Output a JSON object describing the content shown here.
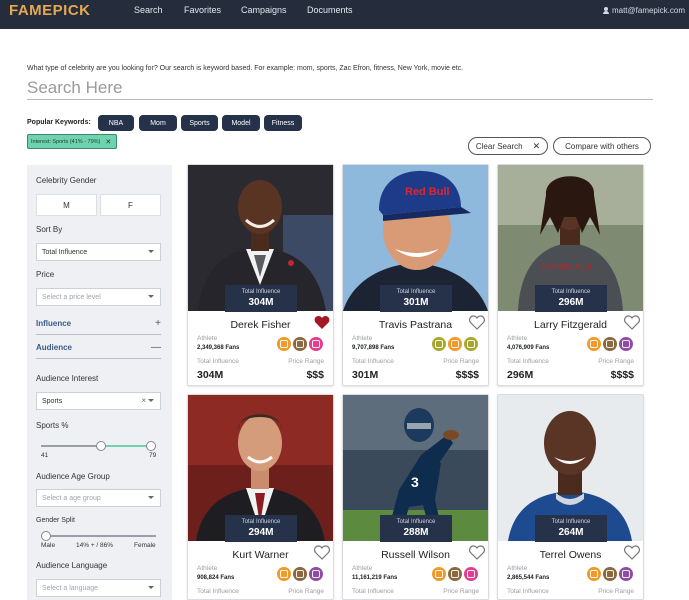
{
  "app": {
    "logo": "FAMEPICK",
    "nav": [
      "Search",
      "Favorites",
      "Campaigns",
      "Documents"
    ],
    "user_email": "matt@famepick.com"
  },
  "search": {
    "hint": "What type of celebrity are you looking for? Our search is keyword based. For example: mom, sports, Zac Efron, fitness, New York, movie etc.",
    "placeholder": "Search Here",
    "popular_label": "Popular Keywords:",
    "keywords": [
      "NBA",
      "Mom",
      "Sports",
      "Model",
      "Fitness"
    ],
    "active_filter": "Interest: Sports (41% - 79%)",
    "clear_label": "Clear Search",
    "compare_label": "Compare with others"
  },
  "sidebar": {
    "gender_label": "Celebrity Gender",
    "gender_m": "M",
    "gender_f": "F",
    "sort_label": "Sort By",
    "sort_value": "Total Influence",
    "price_label": "Price",
    "price_placeholder": "Select a price level",
    "influence_label": "Influence",
    "audience_label": "Audience",
    "interest_label": "Audience Interest",
    "interest_value": "Sports",
    "sports_pct_label": "Sports %",
    "sports_min": "41",
    "sports_max": "79",
    "sports_range": [
      41,
      79
    ],
    "age_label": "Audience Age Group",
    "age_placeholder": "Select a age group",
    "gender_split_label": "Gender Split",
    "split_male": "Male",
    "split_value": "14% + / 86%",
    "split_female": "Female",
    "split_level": 0,
    "language_label": "Audience Language",
    "language_placeholder": "Select a language"
  },
  "card_labels": {
    "total_influence": "Total Influence",
    "price_range": "Price Range"
  },
  "cards": [
    {
      "name": "Derek Fisher",
      "influence": "304M",
      "kind": "Athlete",
      "fans": "2,349,368 Fans",
      "price": "$$$",
      "favorited": true
    },
    {
      "name": "Travis Pastrana",
      "influence": "301M",
      "kind": "Athlete",
      "fans": "9,707,898 Fans",
      "price": "$$$$",
      "favorited": false
    },
    {
      "name": "Larry Fitzgerald",
      "influence": "296M",
      "kind": "Athlete",
      "fans": "4,076,909 Fans",
      "price": "$$$$",
      "favorited": false
    },
    {
      "name": "Kurt Warner",
      "influence": "294M",
      "kind": "Athlete",
      "fans": "908,824 Fans",
      "price": "",
      "favorited": false
    },
    {
      "name": "Russell Wilson",
      "influence": "288M",
      "kind": "Athlete",
      "fans": "11,161,219 Fans",
      "price": "",
      "favorited": false
    },
    {
      "name": "Terrel Owens",
      "influence": "264M",
      "kind": "Athlete",
      "fans": "2,865,544 Fans",
      "price": "",
      "favorited": false
    }
  ],
  "colors": {
    "topbar": "#252d3c",
    "logo": "#e7a852",
    "keyword_bg": "#26314a",
    "filter_chip": "#6ed3ae",
    "heart_active": "#a31a26",
    "section_text": "#3b5a8a"
  }
}
